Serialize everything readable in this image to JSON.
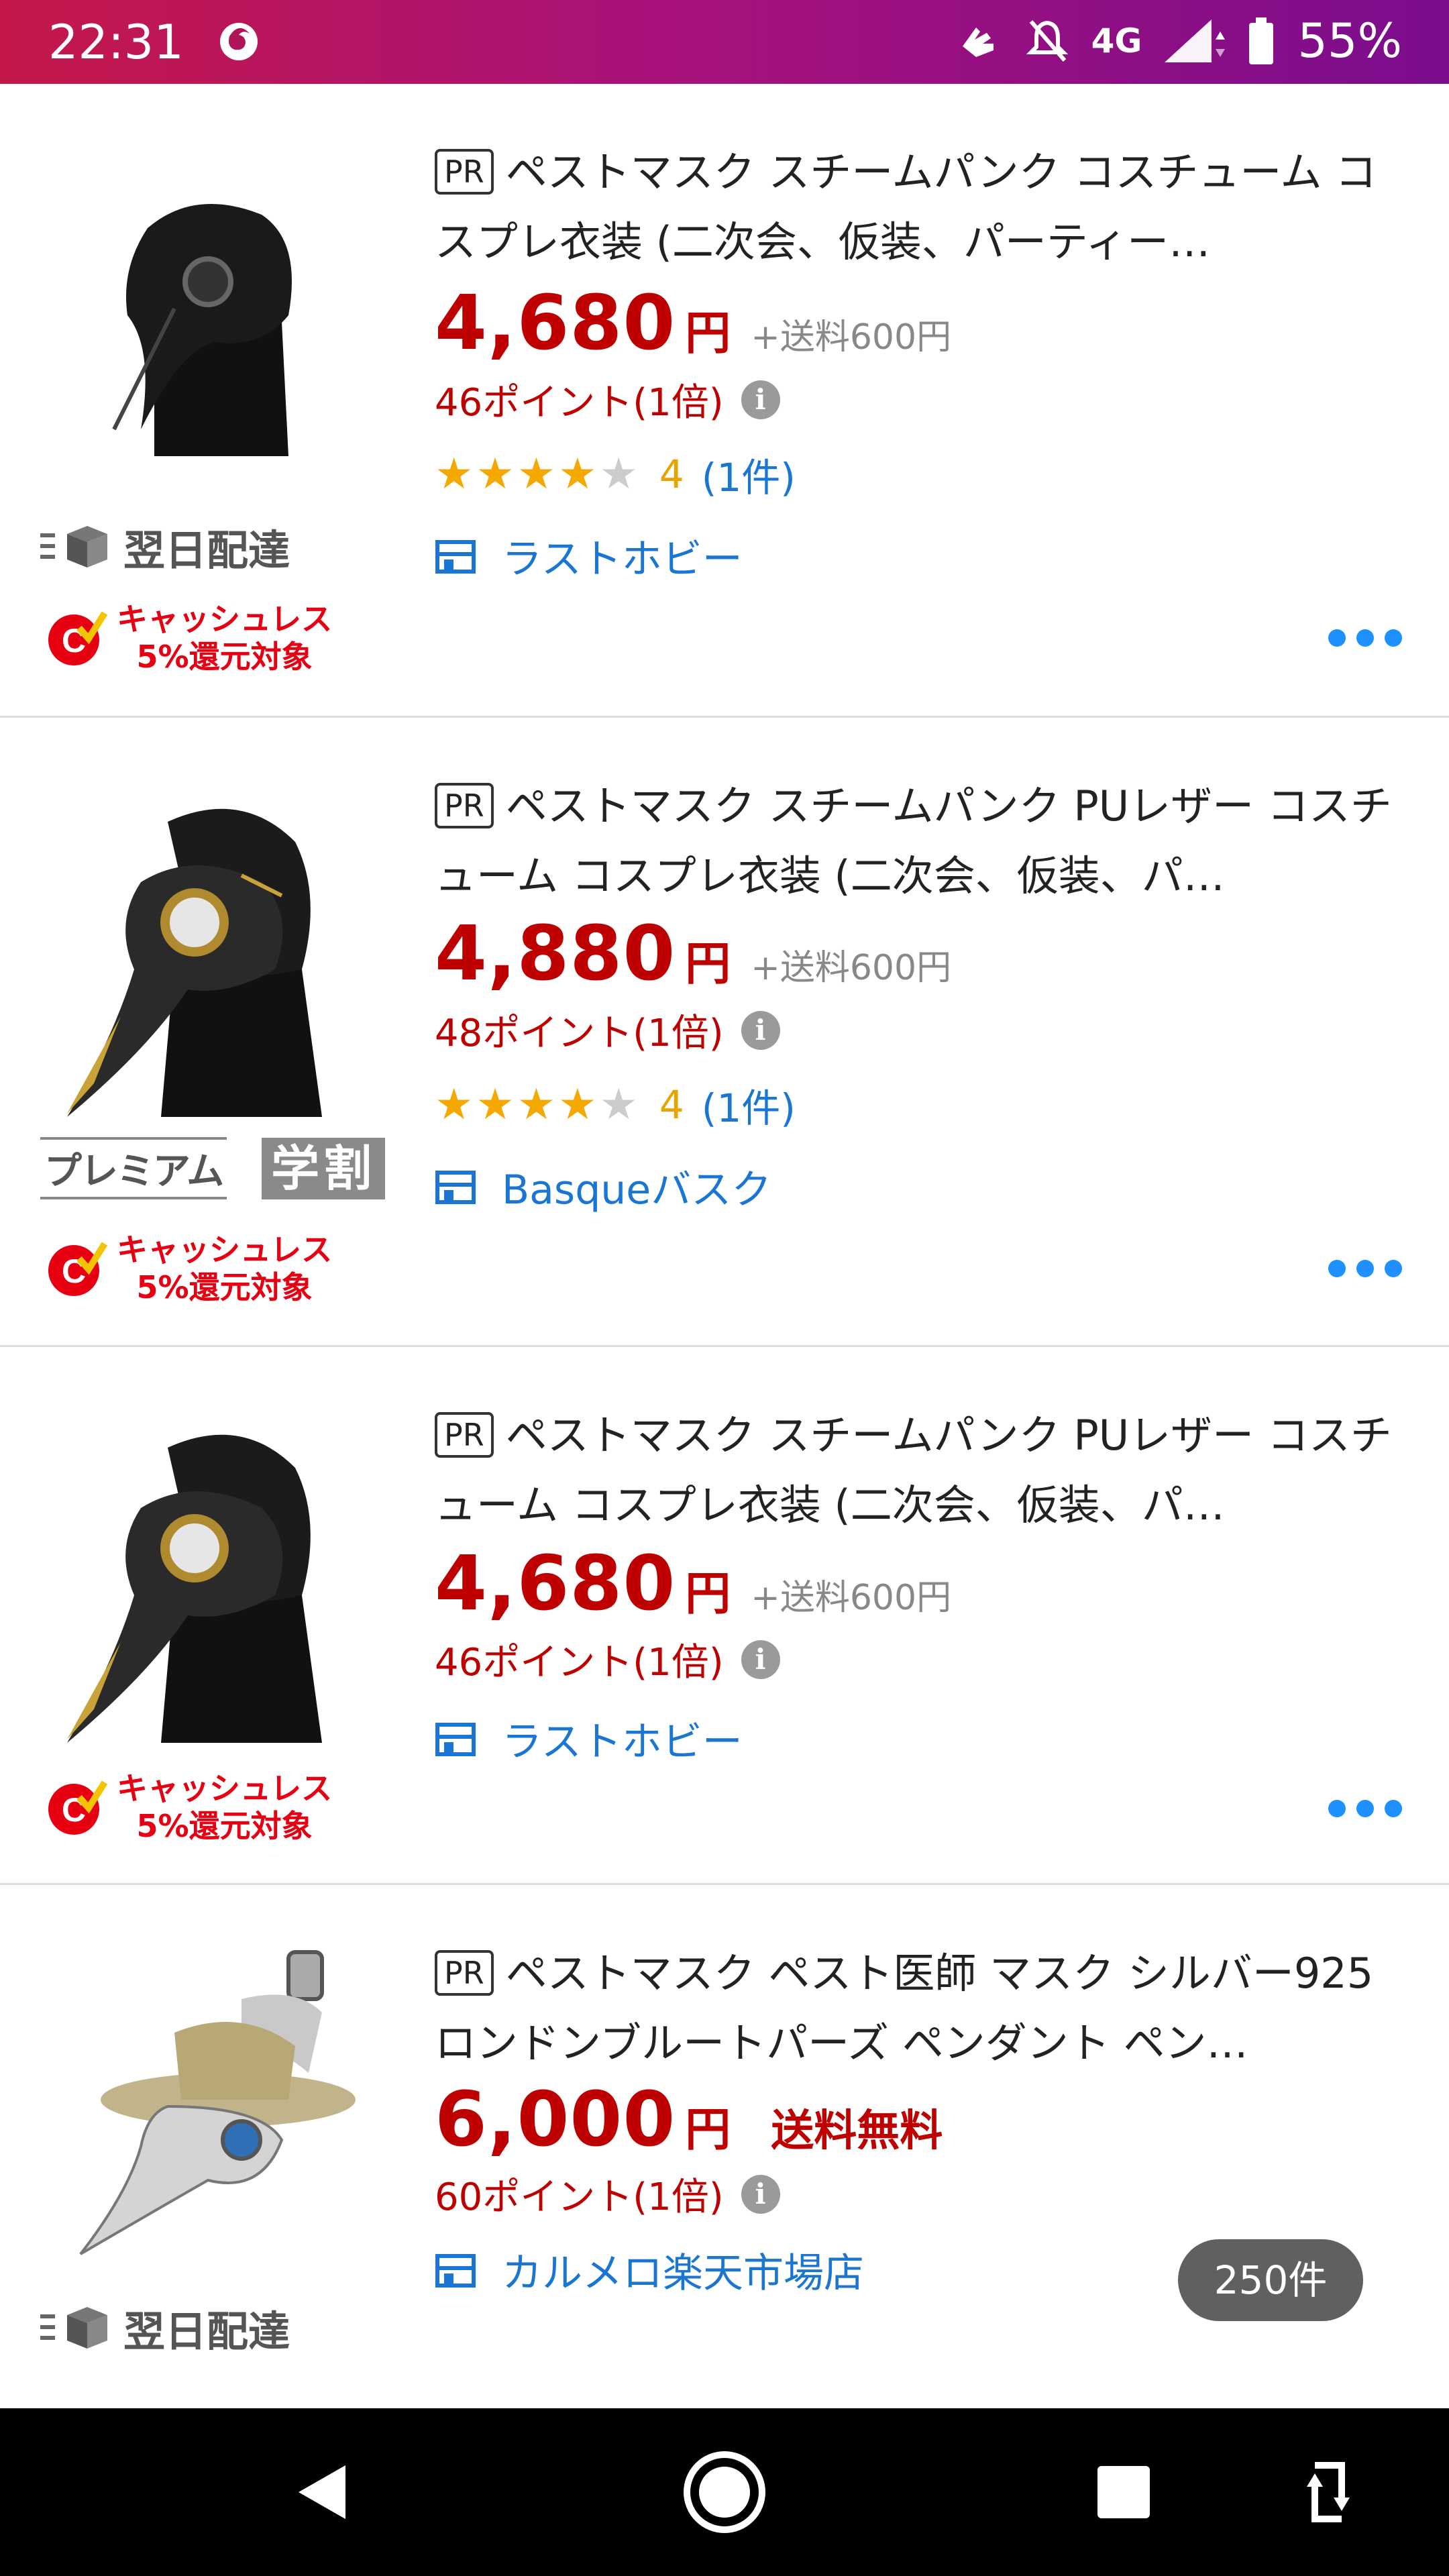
{
  "status_bar": {
    "time": "22:31",
    "network": "4G",
    "battery": "55%",
    "bg_start": "#c4184a",
    "bg_end": "#7b0d8d"
  },
  "products": [
    {
      "pr": "PR",
      "title": "ペストマスク スチームパンク コスチューム コスプレ衣装 (二次会、仮装、パーティー…",
      "price": "4,680",
      "yen": "円",
      "shipping": "+送料600円",
      "points": "46ポイント(1倍)",
      "rating_score": "4",
      "rating_count": "(1件)",
      "stars": 4,
      "shop": "ラストホビー",
      "delivery": "翌日配達",
      "cashless_1": "キャッシュレス",
      "cashless_2": "5%還元対象"
    },
    {
      "pr": "PR",
      "title": "ペストマスク スチームパンク PUレザー コスチューム コスプレ衣装 (二次会、仮装、パ…",
      "price": "4,880",
      "yen": "円",
      "shipping": "+送料600円",
      "points": "48ポイント(1倍)",
      "rating_score": "4",
      "rating_count": "(1件)",
      "stars": 4,
      "shop": "Basqueバスク",
      "premium": "プレミアム",
      "gakuwari": "学割",
      "cashless_1": "キャッシュレス",
      "cashless_2": "5%還元対象"
    },
    {
      "pr": "PR",
      "title": "ペストマスク スチームパンク PUレザー コスチューム コスプレ衣装 (二次会、仮装、パ…",
      "price": "4,680",
      "yen": "円",
      "shipping": "+送料600円",
      "points": "46ポイント(1倍)",
      "shop": "ラストホビー",
      "cashless_1": "キャッシュレス",
      "cashless_2": "5%還元対象"
    },
    {
      "pr": "PR",
      "title": "ペストマスク ペスト医師 マスク シルバー925 ロンドンブルートパーズ ペンダント ペン…",
      "price": "6,000",
      "yen": "円",
      "free_shipping": "送料無料",
      "points": "60ポイント(1倍)",
      "shop": "カルメロ楽天市場店",
      "delivery": "翌日配達"
    }
  ],
  "result_count": "250件",
  "colors": {
    "price_red": "#bf0000",
    "link_blue": "#1a76d2",
    "star": "#f5a800"
  },
  "icons": [
    "info-icon",
    "shop-icon",
    "more-icon",
    "delivery-box-icon",
    "cashless-icon",
    "back-icon",
    "home-icon",
    "recents-icon",
    "rotate-icon"
  ]
}
